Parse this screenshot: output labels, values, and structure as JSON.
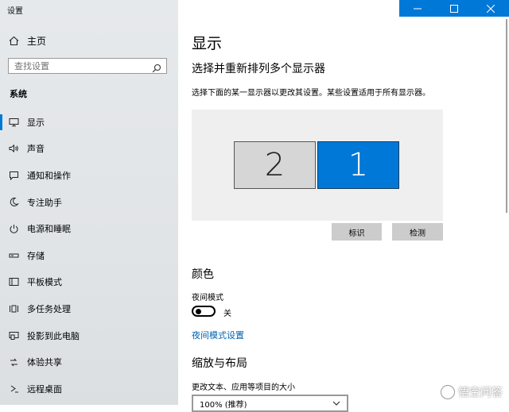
{
  "window": {
    "title": "设置"
  },
  "sidebar": {
    "home_label": "主页",
    "search_placeholder": "查找设置",
    "section_title": "系统",
    "items": [
      {
        "label": "显示",
        "icon": "monitor-icon",
        "active": true
      },
      {
        "label": "声音",
        "icon": "speaker-icon"
      },
      {
        "label": "通知和操作",
        "icon": "notification-icon"
      },
      {
        "label": "专注助手",
        "icon": "moon-icon"
      },
      {
        "label": "电源和睡眠",
        "icon": "power-icon"
      },
      {
        "label": "存储",
        "icon": "storage-icon"
      },
      {
        "label": "平板模式",
        "icon": "tablet-icon"
      },
      {
        "label": "多任务处理",
        "icon": "multitask-icon"
      },
      {
        "label": "投影到此电脑",
        "icon": "project-icon"
      },
      {
        "label": "体验共享",
        "icon": "share-icon"
      },
      {
        "label": "远程桌面",
        "icon": "remote-icon"
      }
    ]
  },
  "main": {
    "title": "显示",
    "arrange_heading": "选择并重新排列多个显示器",
    "arrange_desc": "选择下面的某一显示器以更改其设置。某些设置适用于所有显示器。",
    "monitors": [
      {
        "label": "2",
        "selected": false
      },
      {
        "label": "1",
        "selected": true
      }
    ],
    "identify_label": "标识",
    "detect_label": "检测",
    "color_heading": "颜色",
    "night_light_label": "夜间模式",
    "night_light_state": "关",
    "night_light_link": "夜间模式设置",
    "scale_heading": "缩放与布局",
    "scale_label": "更改文本、应用等项目的大小",
    "scale_value": "100% (推荐)"
  },
  "watermark": "悟空问答",
  "colors": {
    "accent": "#0078d7",
    "link": "#0063b1"
  }
}
